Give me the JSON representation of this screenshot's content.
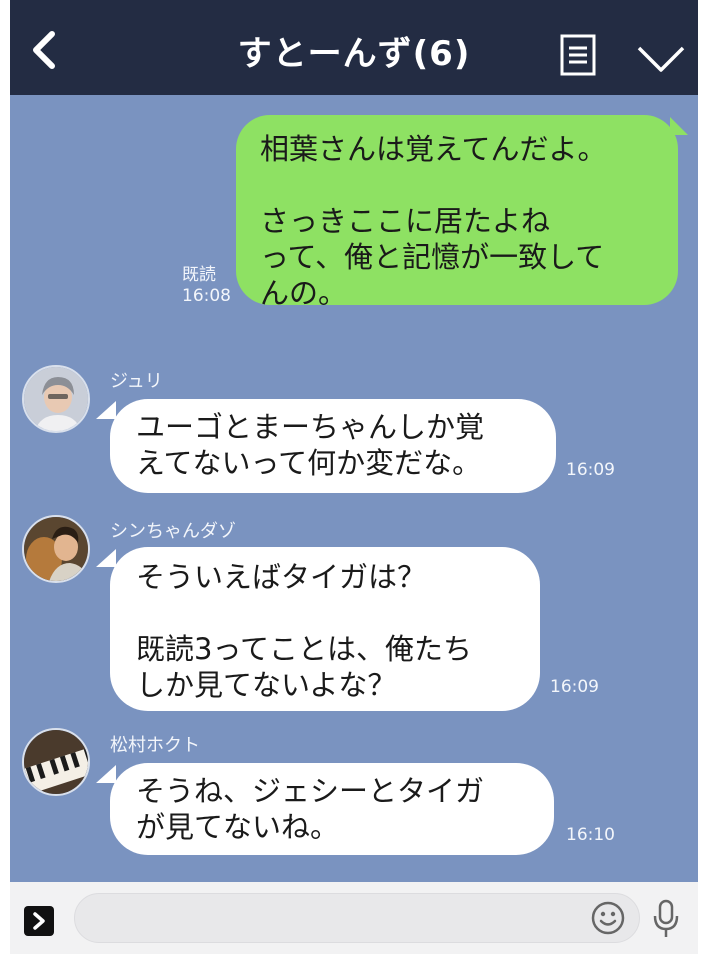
{
  "header": {
    "title": "すとーんず(6)"
  },
  "messages": [
    {
      "type": "sent",
      "text": "相葉さんは覚えてんだよ。\n\nさっきここに居たよね\nって、俺と記憶が一致して\nんの。",
      "read_label": "既読",
      "time": "16:08"
    },
    {
      "type": "received",
      "sender": "ジュリ",
      "text": "ユーゴとまーちゃんしか覚\nえてないって何か変だな。",
      "time": "16:09"
    },
    {
      "type": "received",
      "sender": "シンちゃんダゾ",
      "text": "そういえばタイガは？\n\n既読3ってことは、俺たち\nしか見てないよな？",
      "time": "16:09"
    },
    {
      "type": "received",
      "sender": "松村ホクト",
      "text": "そうね、ジェシーとタイガ\nが見てないね。",
      "time": "16:10"
    }
  ],
  "input": {
    "value": "",
    "placeholder": ""
  },
  "colors": {
    "header_bg": "#232c43",
    "chat_bg": "#7a93c0",
    "sent_bubble": "#8ee163",
    "received_bubble": "#ffffff"
  },
  "icons": [
    "back-arrow-icon",
    "menu-icon",
    "chevron-down-icon",
    "expand-icon",
    "emoji-icon",
    "microphone-icon"
  ]
}
